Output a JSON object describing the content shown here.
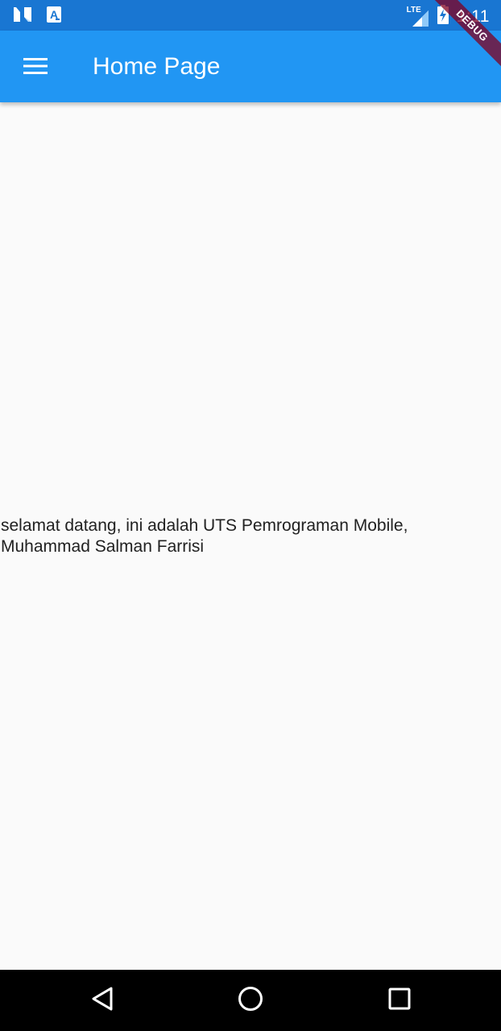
{
  "status_bar": {
    "time": "1:11",
    "network_label": "LTE",
    "icons": [
      "n-logo-icon",
      "text-a-icon",
      "lte-signal-icon",
      "battery-charging-icon"
    ],
    "color": "#1976d2"
  },
  "app_bar": {
    "title": "Home Page",
    "menu_icon": "hamburger-menu-icon",
    "color": "#2196f3"
  },
  "debug_banner": {
    "label": "DEBUG"
  },
  "body": {
    "text": "selamat datang, ini adalah UTS Pemrograman Mobile, Muhammad Salman Farrisi",
    "background": "#fafafa"
  },
  "nav_bar": {
    "icons": [
      "back-triangle-icon",
      "home-circle-icon",
      "recents-square-icon"
    ]
  }
}
